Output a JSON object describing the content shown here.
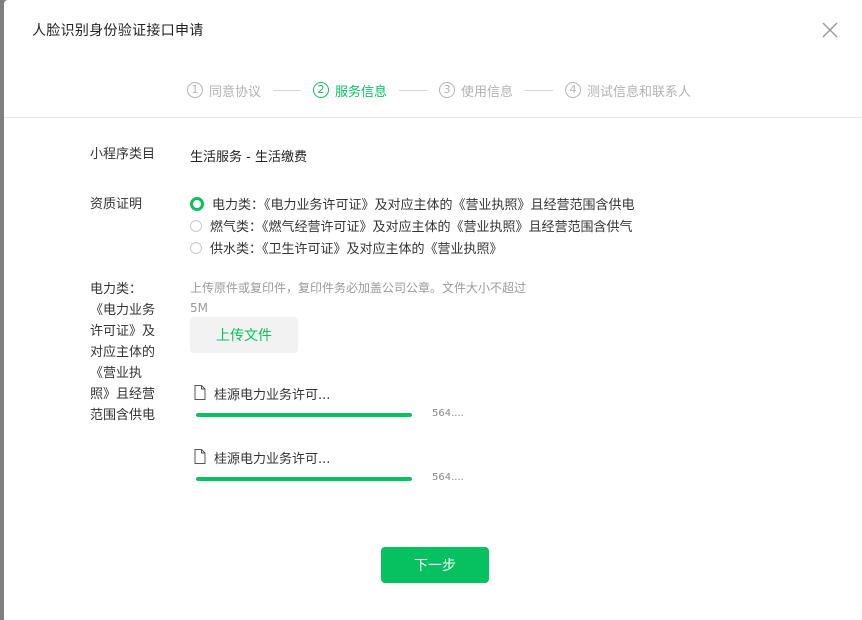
{
  "dialog": {
    "title": "人脸识别身份验证接口申请"
  },
  "steps": [
    {
      "num": "1",
      "label": "同意协议",
      "active": false
    },
    {
      "num": "2",
      "label": "服务信息",
      "active": true
    },
    {
      "num": "3",
      "label": "使用信息",
      "active": false
    },
    {
      "num": "4",
      "label": "测试信息和联系人",
      "active": false
    }
  ],
  "form": {
    "category_label": "小程序类目",
    "category_value": "生活服务 - 生活缴费",
    "qualification_label": "资质证明",
    "qualification_options": [
      {
        "label": "电力类：《电力业务许可证》及对应主体的《营业执照》且经营范围含供电",
        "checked": true
      },
      {
        "label": "燃气类：《燃气经营许可证》及对应主体的《营业执照》且经营范围含供气",
        "checked": false
      },
      {
        "label": "供水类：《卫生许可证》及对应主体的《营业执照》",
        "checked": false
      }
    ],
    "upload_label": "电力类：《电力业务许可证》及对应主体的《营业执照》且经营范围含供电",
    "upload_label_lines": [
      "电力类：",
      "《电力业务",
      "许可证》及",
      "对应主体的",
      "《营业执",
      "照》且经营",
      "范围含供电"
    ],
    "upload_tip": "上传原件或复印件，复印件务必加盖公司公章。文件大小不超过5M",
    "upload_button": "上传文件",
    "files": [
      {
        "name": "桂源电力业务许可...",
        "size": "564....",
        "progress": 1.0
      },
      {
        "name": "桂源电力业务许可...",
        "size": "564....",
        "progress": 1.0
      }
    ]
  },
  "footer": {
    "next_button": "下一步"
  },
  "colors": {
    "accent": "#07c160",
    "muted": "#b2b2b2"
  },
  "icons": {
    "close": "close-icon",
    "file": "file-icon",
    "radio": "radio-icon"
  }
}
